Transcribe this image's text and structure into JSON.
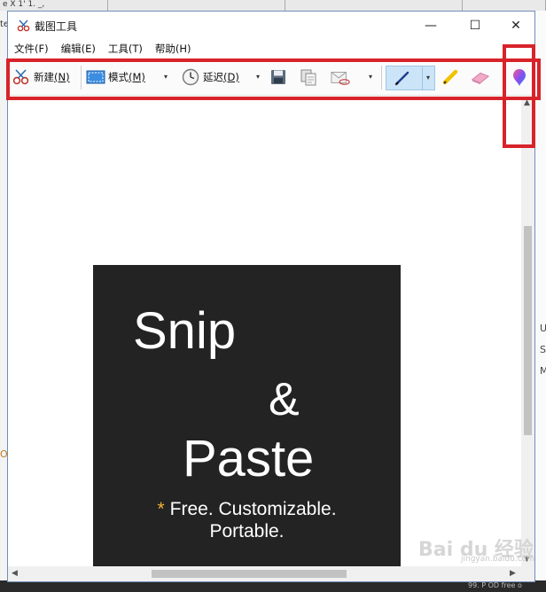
{
  "background": {
    "tabs": [
      "e X 1' 1. _,",
      "",
      "",
      "",
      "",
      "",
      ""
    ],
    "left_edge_text": "te",
    "left_edge_mark": "O",
    "right_edge_letters": [
      "U",
      "S",
      "M"
    ],
    "bottom_right_text": "99. P OD free o"
  },
  "window": {
    "title": "截图工具",
    "controls": {
      "minimize": "—",
      "maximize": "☐",
      "close": "✕"
    }
  },
  "menu": [
    {
      "label": "文件(F)"
    },
    {
      "label": "编辑(E)"
    },
    {
      "label": "工具(T)"
    },
    {
      "label": "帮助(H)"
    }
  ],
  "toolbar": {
    "new_label": "新建",
    "new_key": "(N)",
    "mode_label": "模式",
    "mode_key": "(M)",
    "delay_label": "延迟",
    "delay_key": "(D)",
    "dropdown_glyph": "▾"
  },
  "promo": {
    "line1": "Snip",
    "line2": "&",
    "line3": "Paste",
    "tag_star": "*",
    "tag1": "Free. Customizable.",
    "tag2": "Portable."
  },
  "watermark": {
    "text": "Bai du 经验",
    "sub": "jingyan.baidu.com"
  },
  "colors": {
    "highlight": "#d8232a",
    "promo_bg": "#232323",
    "accent_star": "#f2b035",
    "pen_selected_bg": "#cce4f7"
  },
  "icons": {
    "app": "scissors-snip-icon",
    "new": "scissors-new-icon",
    "mode": "rectangle-mode-icon",
    "delay": "clock-icon",
    "save": "floppy-save-icon",
    "copy": "copy-icon",
    "send": "envelope-send-icon",
    "pen": "pen-icon",
    "highlighter": "highlighter-icon",
    "eraser": "eraser-icon",
    "paint3d": "paint3d-icon"
  }
}
